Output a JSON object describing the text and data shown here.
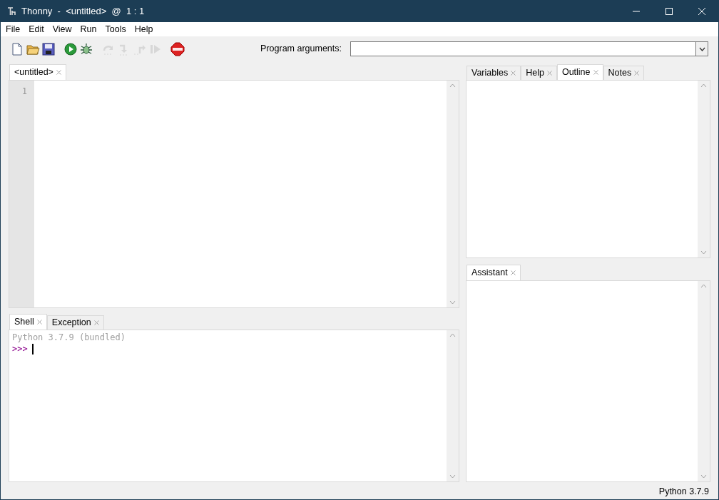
{
  "window": {
    "title": "Thonny  -  <untitled>  @  1 : 1"
  },
  "menu": [
    "File",
    "Edit",
    "View",
    "Run",
    "Tools",
    "Help"
  ],
  "toolbar": [
    {
      "kind": "new",
      "disabled": false
    },
    {
      "kind": "open",
      "disabled": false
    },
    {
      "kind": "save",
      "disabled": false
    },
    {
      "kind": "run",
      "disabled": false
    },
    {
      "kind": "debug",
      "disabled": false
    },
    {
      "kind": "step-over",
      "disabled": true
    },
    {
      "kind": "step-into",
      "disabled": true
    },
    {
      "kind": "step-out",
      "disabled": true
    },
    {
      "kind": "resume",
      "disabled": true
    },
    {
      "kind": "stop",
      "disabled": false
    }
  ],
  "program_arguments": {
    "label": "Program arguments:"
  },
  "editor": {
    "tabs": [
      {
        "label": "<untitled>",
        "selected": true
      }
    ],
    "line_numbers": [
      "1"
    ]
  },
  "shell": {
    "tabs": [
      {
        "label": "Shell",
        "selected": true
      },
      {
        "label": "Exception",
        "selected": false
      }
    ],
    "banner": "Python 3.7.9 (bundled)",
    "prompt": ">>>"
  },
  "side_panel": {
    "tabs": [
      {
        "label": "Variables",
        "selected": false
      },
      {
        "label": "Help",
        "selected": false
      },
      {
        "label": "Outline",
        "selected": true
      },
      {
        "label": "Notes",
        "selected": false
      }
    ]
  },
  "assistant": {
    "tabs": [
      {
        "label": "Assistant",
        "selected": true
      }
    ]
  },
  "status_bar": "Python 3.7.9"
}
